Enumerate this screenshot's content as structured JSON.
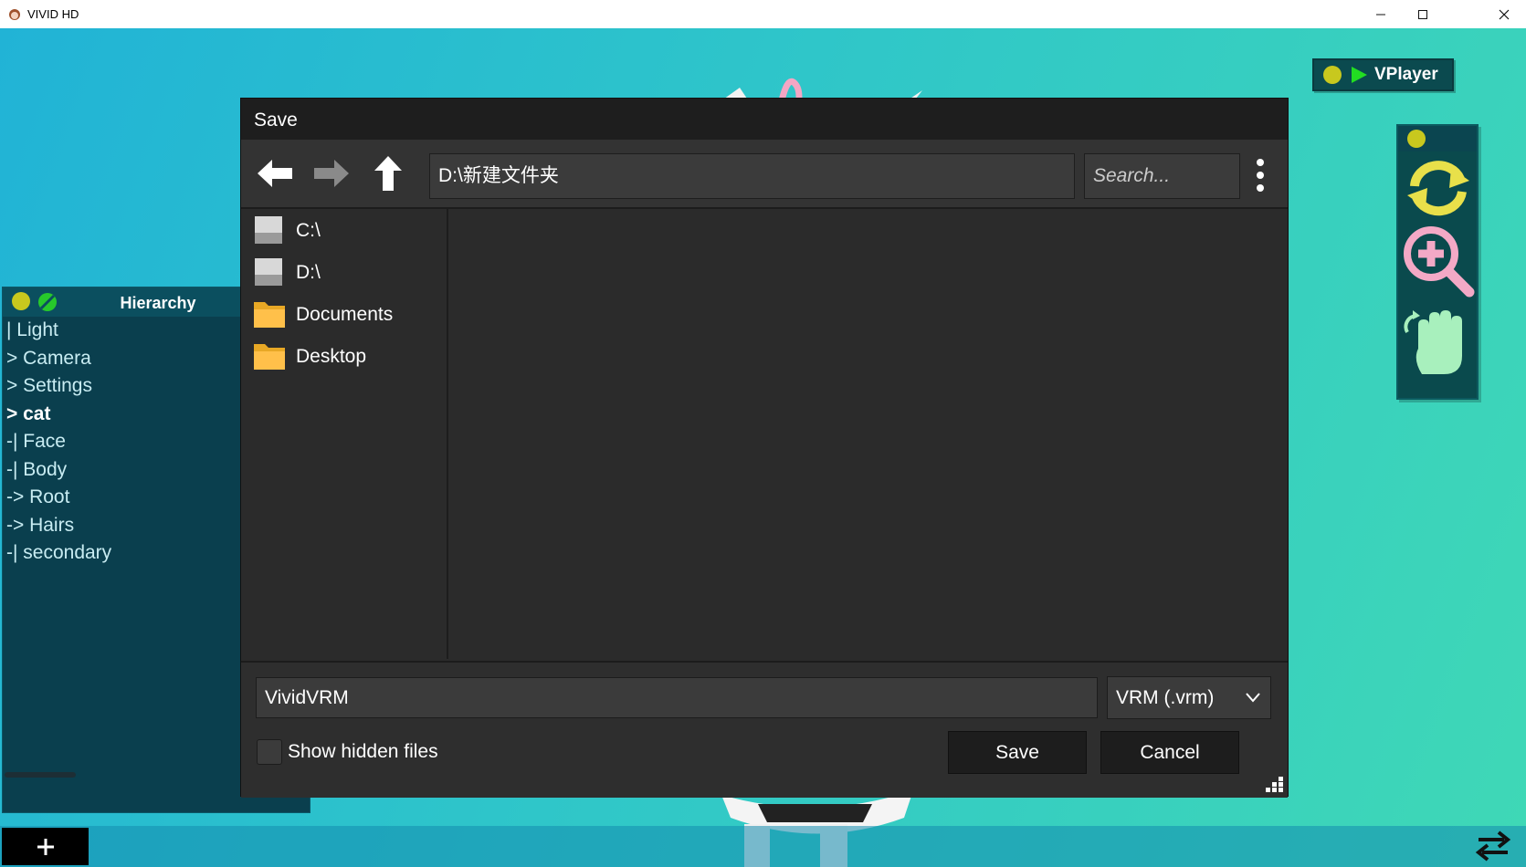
{
  "window": {
    "title": "VIVID HD",
    "controls": [
      "minimize",
      "maximize",
      "close"
    ]
  },
  "hierarchy": {
    "title": "Hierarchy",
    "items": [
      {
        "label": "| Light",
        "selected": false
      },
      {
        "label": "> Camera",
        "selected": false
      },
      {
        "label": "> Settings",
        "selected": false
      },
      {
        "label": "> cat",
        "selected": true
      },
      {
        "label": "-| Face",
        "selected": false
      },
      {
        "label": "-| Body",
        "selected": false
      },
      {
        "label": "-> Root",
        "selected": false
      },
      {
        "label": "-> Hairs",
        "selected": false
      },
      {
        "label": "-| secondary",
        "selected": false
      }
    ]
  },
  "vplayer": {
    "label": "VPlayer"
  },
  "dialog": {
    "title": "Save",
    "path": "D:\\新建文件夹",
    "search_placeholder": "Search...",
    "places": [
      {
        "label": "C:\\",
        "icon": "drive-icon"
      },
      {
        "label": "D:\\",
        "icon": "drive-icon"
      },
      {
        "label": "Documents",
        "icon": "folder-icon"
      },
      {
        "label": "Desktop",
        "icon": "folder-icon"
      }
    ],
    "filename": "VividVRM",
    "filetype": "VRM (.vrm)",
    "show_hidden_label": "Show hidden files",
    "show_hidden_checked": false,
    "save_label": "Save",
    "cancel_label": "Cancel"
  },
  "bottom": {
    "add_label": "+"
  },
  "colors": {
    "accent_yellow": "#c8c81e",
    "play_green": "#22dd22",
    "tool_yellow": "#e8e04a",
    "tool_pink": "#f3a9c6",
    "tool_green": "#a8f0bd"
  }
}
